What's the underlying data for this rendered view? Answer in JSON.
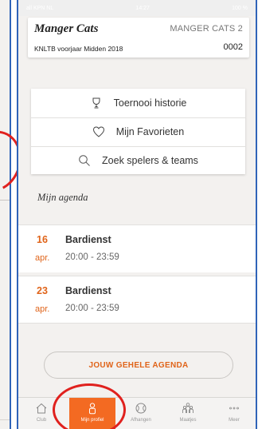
{
  "status_bar": {
    "carrier": "all KPN NL",
    "time": "14:27",
    "battery": "100 %"
  },
  "team": {
    "name": "Manger Cats",
    "code": "MANGER CATS 2",
    "competition": "KNLTB voorjaar Midden 2018",
    "number": "0002"
  },
  "links": [
    {
      "label": "Toernooi historie",
      "icon": "trophy-icon"
    },
    {
      "label": "Mijn Favorieten",
      "icon": "heart-icon"
    },
    {
      "label": "Zoek spelers & teams",
      "icon": "search-icon"
    }
  ],
  "agenda": {
    "heading": "Mijn agenda",
    "items": [
      {
        "day": "16",
        "month": "apr.",
        "title": "Bardienst",
        "time": "20:00 - 23:59"
      },
      {
        "day": "23",
        "month": "apr.",
        "title": "Bardienst",
        "time": "20:00 - 23:59"
      }
    ],
    "button_label": "JOUW GEHELE AGENDA"
  },
  "tabs": [
    {
      "label": "Club",
      "icon": "home-icon",
      "active": false
    },
    {
      "label": "Mijn profiel",
      "icon": "profile-icon",
      "active": true
    },
    {
      "label": "Afhangen",
      "icon": "tennis-ball-icon",
      "active": false
    },
    {
      "label": "Maatjes",
      "icon": "friends-icon",
      "active": false
    },
    {
      "label": "Meer",
      "icon": "more-icon",
      "active": false
    }
  ],
  "colors": {
    "accent": "#f36a22",
    "agenda_orange": "#e0641a",
    "annotation_red": "#e0211e",
    "frame_blue": "#2f63b8"
  }
}
